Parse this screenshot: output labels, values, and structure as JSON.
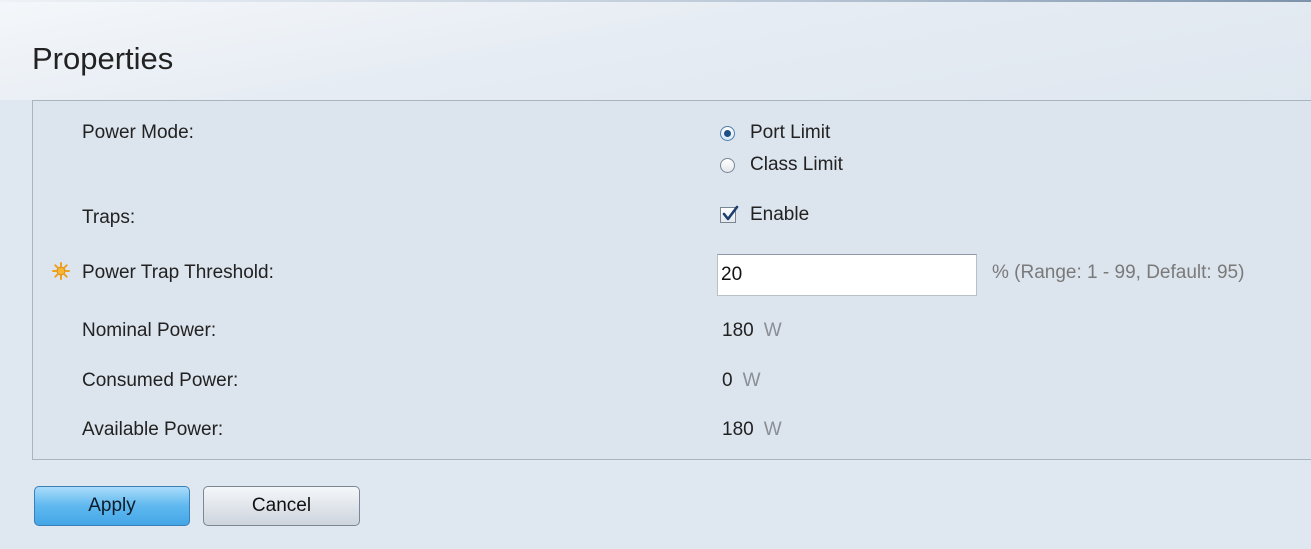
{
  "page": {
    "title": "Properties"
  },
  "form": {
    "power_mode": {
      "label": "Power Mode:",
      "options": [
        {
          "label": "Port Limit",
          "selected": true
        },
        {
          "label": "Class Limit",
          "selected": false
        }
      ]
    },
    "traps": {
      "label": "Traps:",
      "checkbox_label": "Enable",
      "checked": true
    },
    "power_trap_threshold": {
      "label": "Power Trap Threshold:",
      "value": "20",
      "hint": "% (Range: 1 - 99, Default: 95)",
      "required_icon": "required-sun-icon"
    },
    "nominal_power": {
      "label": "Nominal Power:",
      "value": "180",
      "unit": "W"
    },
    "consumed_power": {
      "label": "Consumed Power:",
      "value": "0",
      "unit": "W"
    },
    "available_power": {
      "label": "Available Power:",
      "value": "180",
      "unit": "W"
    }
  },
  "buttons": {
    "apply": "Apply",
    "cancel": "Cancel"
  },
  "colors": {
    "background": "#dfe7f0",
    "apply_button": "#5fb8ef",
    "required_icon": "#f0a020",
    "hint_text": "#7a7a7a"
  }
}
